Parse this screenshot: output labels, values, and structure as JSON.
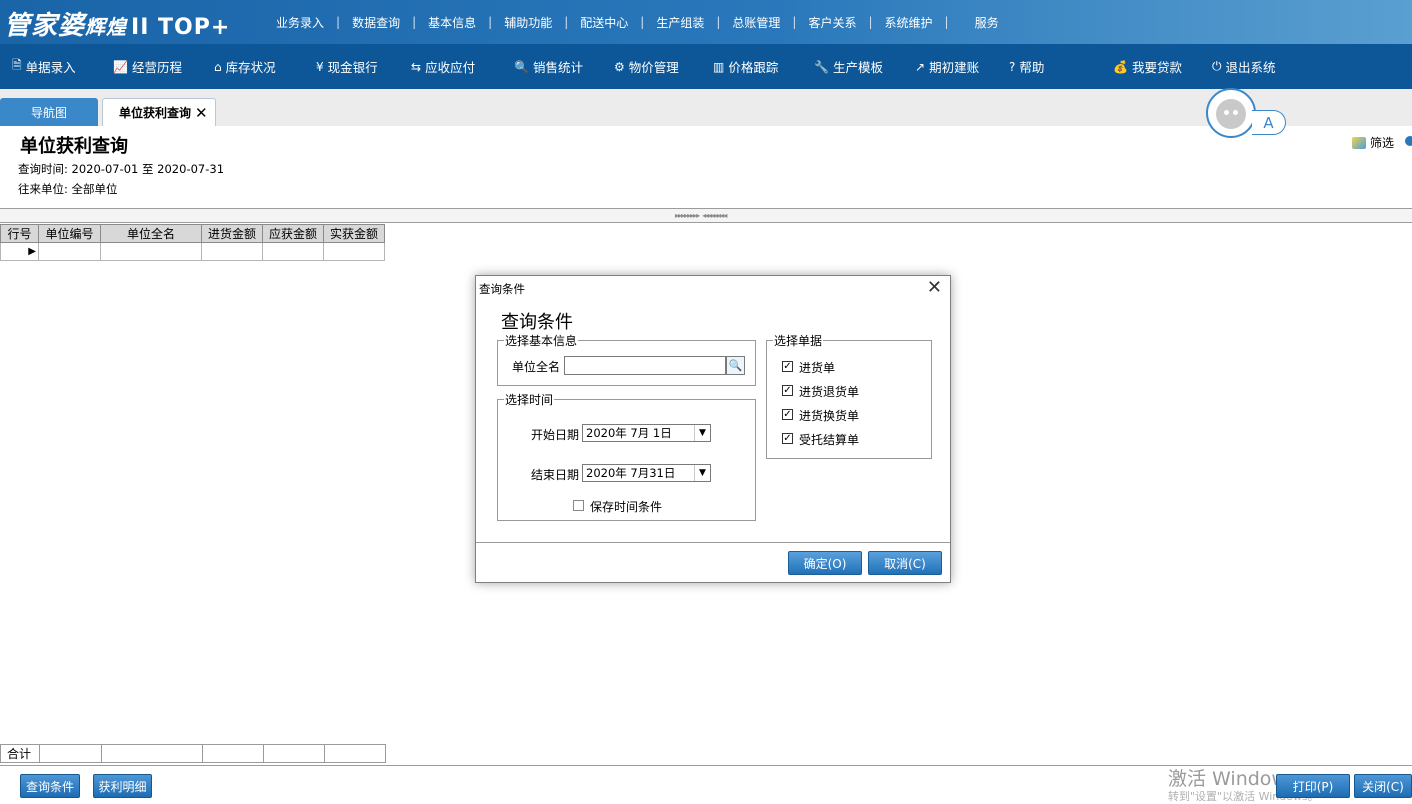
{
  "app": {
    "logo_main": "管家婆",
    "logo_sub": "辉煌",
    "logo_edition": "II TOP+"
  },
  "top_menu": [
    "业务录入",
    "数据查询",
    "基本信息",
    "辅助功能",
    "配送中心",
    "生产组装",
    "总账管理",
    "客户关系",
    "系统维护",
    "服务"
  ],
  "toolbar": [
    {
      "label": "单据录入",
      "icon": "document-icon"
    },
    {
      "label": "经营历程",
      "icon": "line-chart-icon"
    },
    {
      "label": "库存状况",
      "icon": "home-icon"
    },
    {
      "label": "现金银行",
      "icon": "yen-icon"
    },
    {
      "label": "应收应付",
      "icon": "exchange-icon"
    },
    {
      "label": "销售统计",
      "icon": "search-icon"
    },
    {
      "label": "物价管理",
      "icon": "gear-icon"
    },
    {
      "label": "价格跟踪",
      "icon": "bar-chart-icon"
    },
    {
      "label": "生产模板",
      "icon": "wrench-icon"
    },
    {
      "label": "期初建账",
      "icon": "external-link-icon"
    },
    {
      "label": "帮助",
      "icon": "question-icon"
    },
    {
      "label": "我要贷款",
      "icon": "money-bag-icon"
    },
    {
      "label": "退出系统",
      "icon": "power-icon"
    }
  ],
  "tabs": {
    "nav": "导航图",
    "active": "单位获利查询",
    "close": "✕"
  },
  "avatar_badge": "A",
  "page": {
    "title": "单位获利查询",
    "query_time": "查询时间: 2020-07-01 至 2020-07-31",
    "partner": "往来单位: 全部单位",
    "filter": "筛选"
  },
  "grid": {
    "columns": [
      "行号",
      "单位编号",
      "单位全名",
      "进货金额",
      "应获金额",
      "实获金额"
    ],
    "total_label": "合计"
  },
  "bottom": {
    "query_btn": "查询条件",
    "detail_btn": "获利明细",
    "print_btn": "打印(P)",
    "close_btn": "关闭(C)",
    "watermark": "激活 Windows",
    "watermark_sub": "转到\"设置\"以激活 Windows。"
  },
  "dialog": {
    "title": "查询条件",
    "heading": "查询条件",
    "group_basic": "选择基本信息",
    "unit_label": "单位全名",
    "unit_value": "",
    "group_time": "选择时间",
    "start_label": "开始日期",
    "start_value": "2020年  7月  1日",
    "end_label": "结束日期",
    "end_value": "2020年  7月31日",
    "save_time": "保存时间条件",
    "save_time_checked": false,
    "group_bills": "选择单据",
    "bills": [
      {
        "label": "进货单",
        "checked": true
      },
      {
        "label": "进货退货单",
        "checked": true
      },
      {
        "label": "进货换货单",
        "checked": true
      },
      {
        "label": "受托结算单",
        "checked": true
      }
    ],
    "ok": "确定(O)",
    "cancel": "取消(C)"
  }
}
